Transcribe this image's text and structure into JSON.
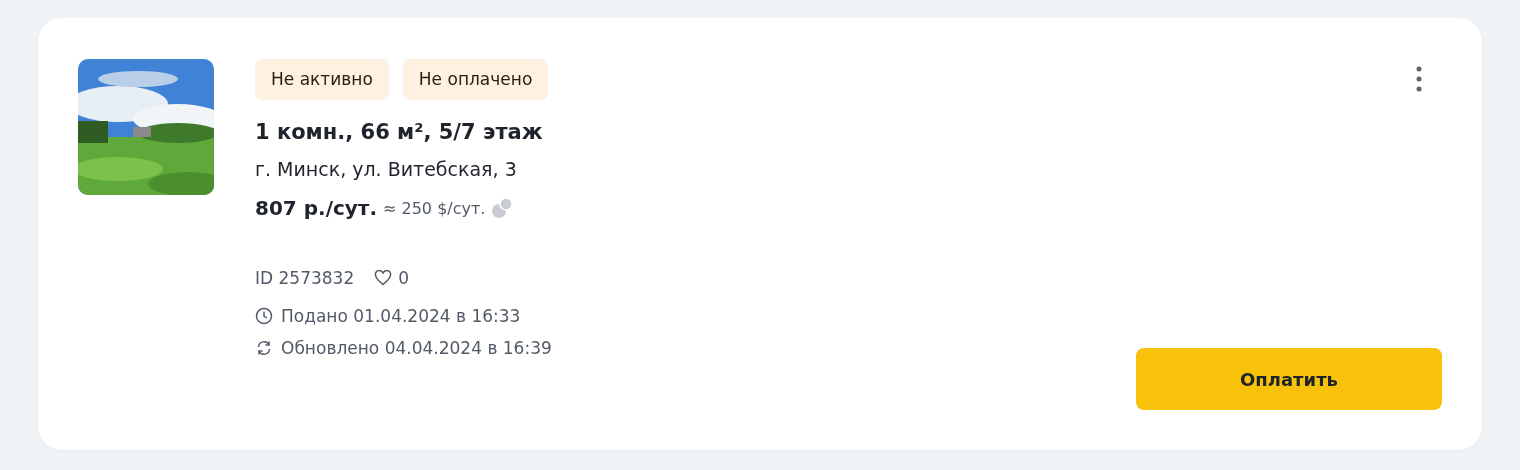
{
  "listing": {
    "badges": [
      "Не активно",
      "Не оплачено"
    ],
    "title": "1 комн., 66 м², 5/7 этаж",
    "address": "г. Минск, ул. Витебская, 3",
    "price": "807 р./сут.",
    "price_converted": "≈ 250 $/сут.",
    "id": "ID 2573832",
    "favorites": "0",
    "posted": "Подано 01.04.2024 в 16:33",
    "updated": "Обновлено 04.04.2024 в 16:39",
    "pay_button": "Оплатить"
  }
}
